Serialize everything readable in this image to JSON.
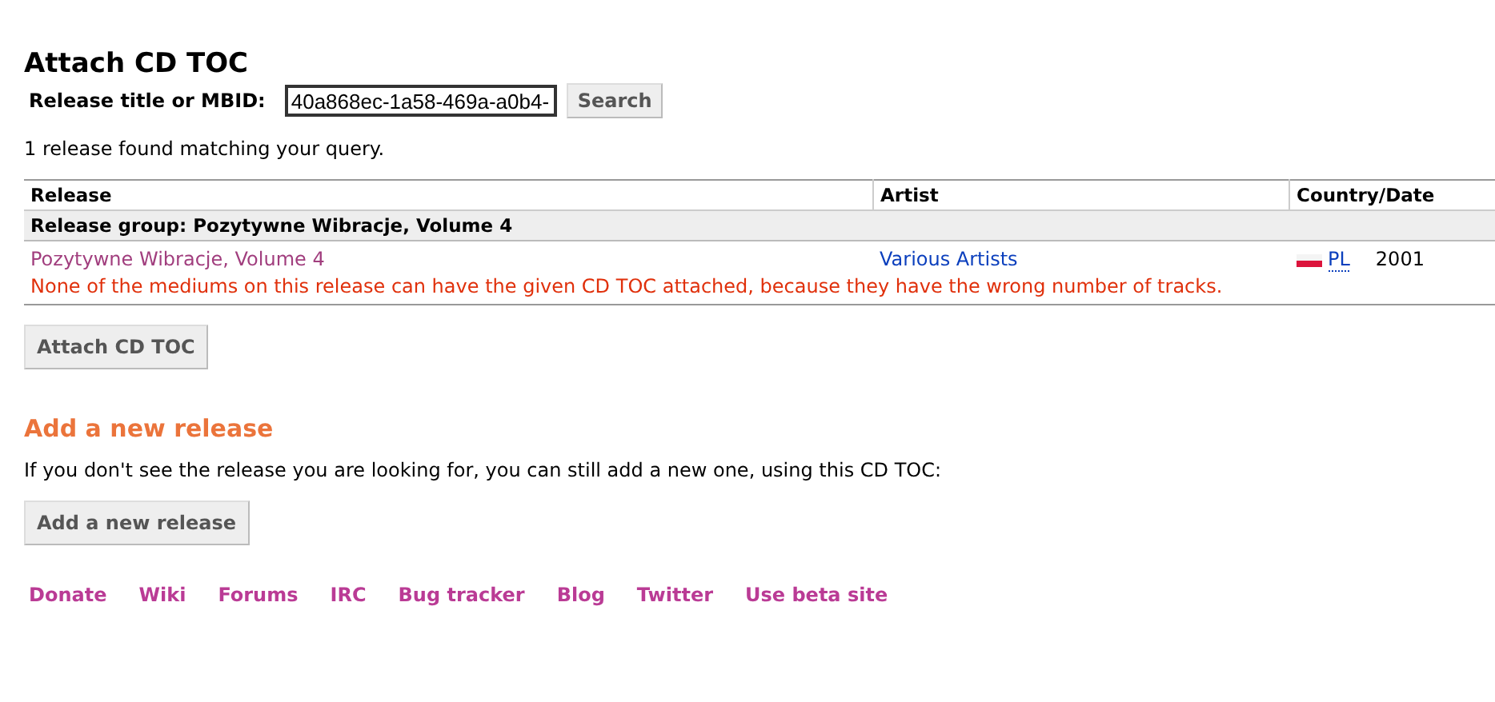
{
  "title": "Attach CD TOC",
  "search": {
    "label": "Release title or MBID:",
    "value": "40a868ec-1a58-469a-a0b4-",
    "button": "Search"
  },
  "result_count": "1 release found matching your query.",
  "table": {
    "columns": [
      "Release",
      "Artist",
      "Country/Date"
    ],
    "groups": [
      {
        "title": "Release group: Pozytywne Wibracje, Volume 4",
        "rows": [
          {
            "release": "Pozytywne Wibracje, Volume 4",
            "artist": "Various Artists",
            "country": "PL",
            "date": "2001",
            "error": "None of the mediums on this release can have the given CD TOC attached, because they have the wrong number of tracks."
          }
        ]
      }
    ]
  },
  "attach_button": "Attach CD TOC",
  "add_section": {
    "heading": "Add a new release",
    "text": "If you don't see the release you are looking for, you can still add a new one, using this CD TOC:",
    "button": "Add a new release"
  },
  "footer_links": [
    "Donate",
    "Wiki",
    "Forums",
    "IRC",
    "Bug tracker",
    "Blog",
    "Twitter",
    "Use beta site"
  ]
}
